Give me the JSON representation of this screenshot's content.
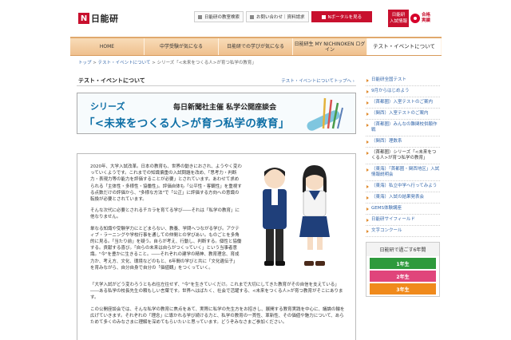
{
  "header": {
    "logo_text": "日能研",
    "logo_mark": "N",
    "links": [
      {
        "label": "日能研の教室検索"
      },
      {
        "label": "お問い合わせ｜資料請求"
      },
      {
        "label": "Nボータルを見る"
      }
    ],
    "exam_button": [
      "日能研",
      "入試情報"
    ],
    "pass_badge": [
      "合格",
      "実績"
    ]
  },
  "nav": [
    {
      "label": "HOME"
    },
    {
      "label": "中学受験が気になる"
    },
    {
      "label": "日能研での学びが気になる"
    },
    {
      "label": "日能研生 MY NICHINOKEN ログイン"
    },
    {
      "label": "テスト・イベントについて"
    }
  ],
  "breadcrumb": {
    "items": [
      "トップ",
      "テスト・イベントについて",
      "シリーズ「<未来をつくる人>が育つ私学の教育」"
    ],
    "separator": " > "
  },
  "main": {
    "section_title": "テスト・イベントについて",
    "section_link": "テスト・イベントについてトップへ",
    "banner": {
      "series": "シリーズ",
      "sponsor": "毎日新聞社主催 私学公開座談会",
      "title": "「<未来をつくる人>が育つ私学の教育」"
    },
    "paragraphs": [
      "2020年、大学入試改革。日本の教育も、世界の動きにおされ、ようやく変わっていくようです。これまでの知識偏重の入試問題を改め、「思考力・判断力・表現力等の能力を評価することが必要」とされています。あわせて求められる「主体性・多様性・協働性」。評価自体も「公平性・客観性」を重視する点数だけの評価から、\"多様な方法\"で「公正」に評価する方向への意識の転換が必要とされています。",
      "そんな次代に必要とされるチカラを育てる学び――それは「私学の教育」に他なりません。",
      "単なる知識や受験学力にとどまらない、教養、学問へつながる学び。アクティブ・ラーニングや学校行事を通しての仲間との学びあい。ものごとを多角的に見る。「当たり前」を疑う。自らが考え、行動し、判断する。個性と協働する。貢献する喜び。「自らの未来は自らがつくっていく」という当事者意識。\"今\"を豊かに生きること。――それぞれの建学の精神、教育理念、育成力か、考え方、文化、環境などのもと、6年間の学びと共に「文化遺伝子」を育みながら、自分自身で自分の「価値観」をつくっていく。",
      "「大学入試がどう変わろうとも右往左往せず、\"今\"を生きていくだけ。これまで大切にしてきた教育がその自信を支えている」――ある私学の校長先生の頼もしい言葉です。世界へはばたく、社会で活躍する、<未来をつくる人>が育つ教育がそこにあります。",
      "この公開座談会では、そんな私学の教育に焦点をあて、実際に私学の先生方をお招きし、展開する教育実践を中心に、議論の輪を広げていきます。それぞれの「理念」に導かれる学び続ける力と、私学の教育の一貫性、革新性、その価値や魅力について、あらためて多くのみなさまに理解を深めてもらいたいと思っています。どうぞみなさまご参加ください。"
    ]
  },
  "sidebar": {
    "items": [
      {
        "label": "日能研全国テスト"
      },
      {
        "label": "9月からはじめよう"
      },
      {
        "label": "（首都圏）入室テストのご案内"
      },
      {
        "label": "（関西）入室テストのご案内"
      },
      {
        "label": "（首都圏）みんなの難関校併願作戦"
      },
      {
        "label": "（関西）理数系"
      },
      {
        "label": "（首都圏）シリーズ「<未来をつくる人>が育つ私学の教育」"
      },
      {
        "label": "（東海）「首都圏・関西地区」入試情報説明会"
      },
      {
        "label": "（東海）私立中学へ行ってみよう"
      },
      {
        "label": "（東海）入試の結果発表会"
      },
      {
        "label": "GEMS体験講座"
      },
      {
        "label": "日能研サイフィールド"
      },
      {
        "label": "文字コンクール"
      }
    ],
    "current_index": 6,
    "year_box": {
      "title": "日能研で過ごす6年間",
      "buttons": [
        {
          "label": "1年生",
          "color": "#2e9a3c"
        },
        {
          "label": "2年生",
          "color": "#e0457b"
        },
        {
          "label": "3年生",
          "color": "#f08a1c"
        }
      ]
    }
  },
  "colors": {
    "brand_red": "#c8102e",
    "banner_blue": "#0e6fa6",
    "nav_orange": "#efc08e",
    "link_blue": "#3366aa"
  }
}
